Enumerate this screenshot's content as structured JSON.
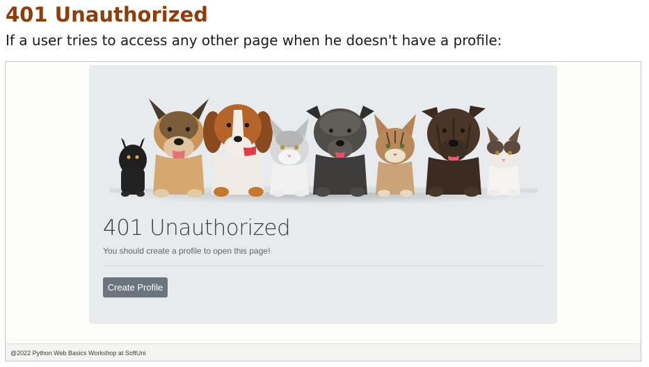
{
  "document": {
    "heading": "401 Unauthorized",
    "description": "If a user tries to access any other page when he doesn't have a profile:"
  },
  "page": {
    "title": "401 Unauthorized",
    "message": "You should create a profile to open this page!",
    "button_label": "Create Profile",
    "footer": "@2022 Python Web Basics Workshop at SoftUni"
  },
  "colors": {
    "heading": "#8f3d0a",
    "jumbotron_bg": "#e8ebed",
    "button_bg": "#6c757d",
    "frame_bg": "#fdfdfa"
  },
  "banner": {
    "animals": [
      "cat-icon",
      "dog-icon",
      "dog-icon",
      "cat-icon",
      "dog-icon",
      "cat-icon",
      "dog-icon",
      "cat-icon"
    ]
  }
}
